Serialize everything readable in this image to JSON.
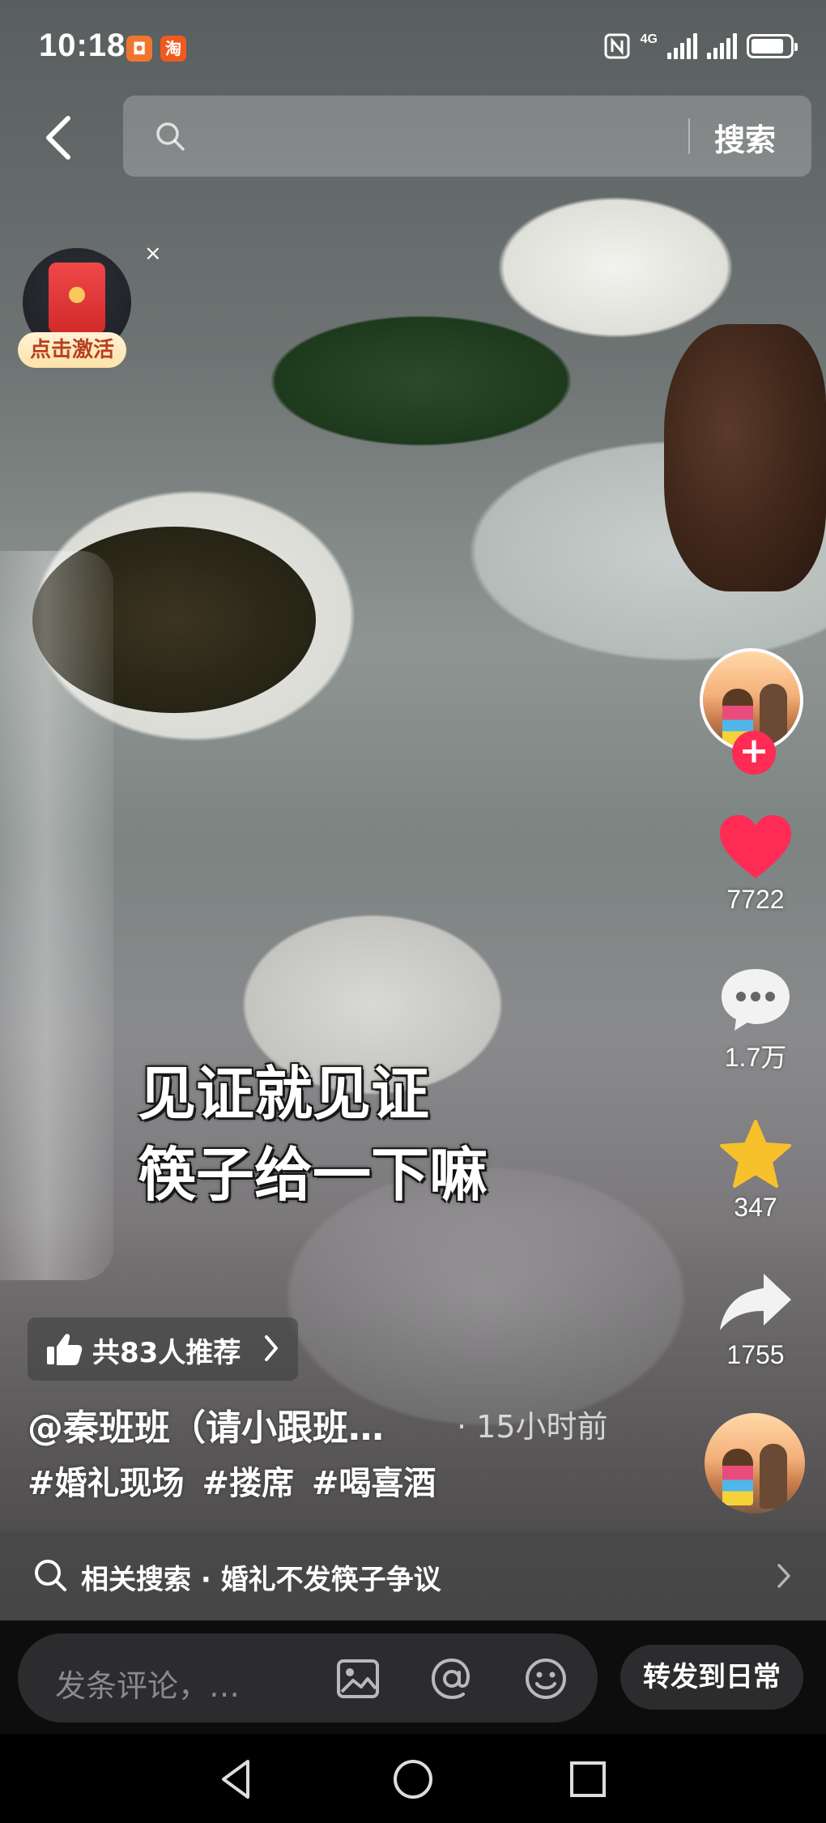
{
  "status_bar": {
    "time": "10:18",
    "app_icons": [
      {
        "name": "notification-app-icon",
        "glyph": "◘",
        "color": "#f0762d"
      },
      {
        "name": "taobao-app-icon",
        "glyph": "淘",
        "color": "#f05a1e"
      }
    ],
    "network_label": "4G",
    "battery_level": 0.85
  },
  "search": {
    "placeholder": "",
    "button_label": "搜索"
  },
  "red_packet": {
    "label": "点击激活",
    "close_glyph": "×"
  },
  "caption": {
    "line1": "见证就见证",
    "line2": "筷子给一下嘛"
  },
  "actions": {
    "follow_glyph": "+",
    "like_count": "7722",
    "comment_count": "1.7万",
    "favorite_count": "347",
    "share_count": "1755"
  },
  "post": {
    "recommend_text": "共83人推荐",
    "author": "@秦班班（请小跟班…",
    "time": "· 15小时前",
    "hashtags": "#婚礼现场 #搂席 #喝喜酒"
  },
  "related": {
    "text": "相关搜索 · 婚礼不发筷子争议"
  },
  "comment": {
    "placeholder": "发条评论，…",
    "forward_label": "转发到日常"
  },
  "colors": {
    "like": "#fe2c55",
    "favorite": "#f7c12b",
    "follow": "#fe2c55"
  }
}
